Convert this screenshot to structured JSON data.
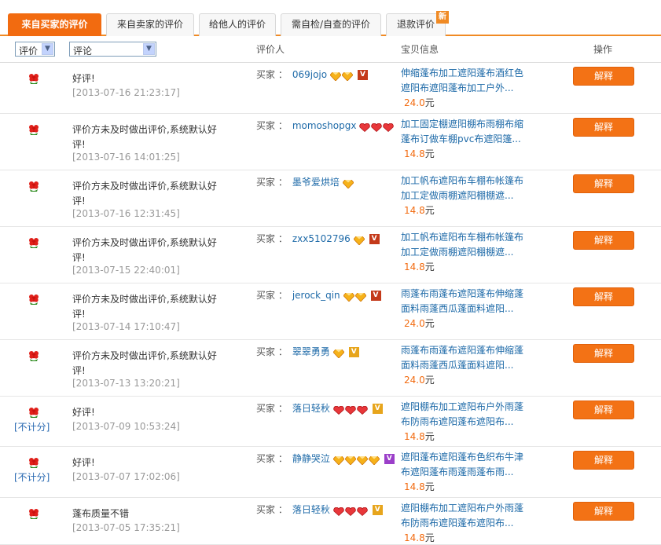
{
  "tabs": [
    {
      "label": "来自买家的评价",
      "active": true
    },
    {
      "label": "来自卖家的评价",
      "active": false
    },
    {
      "label": "给他人的评价",
      "active": false
    },
    {
      "label": "需自检/自查的评价",
      "active": false
    },
    {
      "label": "退款评价",
      "active": false
    }
  ],
  "new_badge": "新",
  "header": {
    "filter_rating": "评价",
    "filter_comment": "评论",
    "col_rater": "评价人",
    "col_item": "宝贝信息",
    "col_action": "操作"
  },
  "colors": {
    "accent": "#f26b10",
    "link": "#1e6aa8",
    "button": "#f37215"
  },
  "rows": [
    {
      "comment": "好评!",
      "time": "[2013-07-16 21:23:17]",
      "no_count": "",
      "buyer_label": "买家 ：",
      "buyer": "069jojo",
      "badges": [
        "diamond",
        "diamond"
      ],
      "level": "tall",
      "item": "伸缩蓬布加工遮阳蓬布酒红色遮阳布遮阳蓬布加工户外...",
      "price": "24.0",
      "price_unit": "元",
      "action": "解释"
    },
    {
      "comment": "评价方未及时做出评价,系统默认好评!",
      "time": "[2013-07-16 14:01:25]",
      "no_count": "",
      "buyer_label": "买家 ：",
      "buyer": "momoshopgx",
      "badges": [
        "heart",
        "heart",
        "heart"
      ],
      "level": "",
      "item": "加工固定棚遮阳棚布雨棚布缩蓬布订做车棚pvc布遮阳篷...",
      "price": "14.8",
      "price_unit": "元",
      "action": "解释"
    },
    {
      "comment": "评价方未及时做出评价,系统默认好评!",
      "time": "[2013-07-16 12:31:45]",
      "no_count": "",
      "buyer_label": "买家 ：",
      "buyer": "墨爷爱烘培",
      "badges": [
        "diamond"
      ],
      "level": "",
      "item": "加工帆布遮阳布车棚布帐篷布加工定做雨棚遮阳棚棚遮...",
      "price": "14.8",
      "price_unit": "元",
      "action": "解释"
    },
    {
      "comment": "评价方未及时做出评价,系统默认好评!",
      "time": "[2013-07-15 22:40:01]",
      "no_count": "",
      "buyer_label": "买家 ：",
      "buyer": "zxx5102796",
      "badges": [
        "diamond"
      ],
      "level": "tall",
      "item": "加工帆布遮阳布车棚布帐篷布加工定做雨棚遮阳棚棚遮...",
      "price": "14.8",
      "price_unit": "元",
      "action": "解释"
    },
    {
      "comment": "评价方未及时做出评价,系统默认好评!",
      "time": "[2013-07-14 17:10:47]",
      "no_count": "",
      "buyer_label": "买家 ：",
      "buyer": "jerock_qin",
      "badges": [
        "diamond",
        "diamond"
      ],
      "level": "tall",
      "item": "雨蓬布雨蓬布遮阳蓬布伸缩蓬面料雨蓬西瓜蓬面料遮阳...",
      "price": "24.0",
      "price_unit": "元",
      "action": "解释"
    },
    {
      "comment": "评价方未及时做出评价,系统默认好评!",
      "time": "[2013-07-13 13:20:21]",
      "no_count": "",
      "buyer_label": "买家 ：",
      "buyer": "翠翠勇勇",
      "badges": [
        "diamond"
      ],
      "level": "gold",
      "item": "雨蓬布雨蓬布遮阳蓬布伸缩蓬面料雨蓬西瓜蓬面料遮阳...",
      "price": "24.0",
      "price_unit": "元",
      "action": "解释"
    },
    {
      "comment": "好评!",
      "time": "[2013-07-09 10:53:24]",
      "no_count": "[不计分]",
      "buyer_label": "买家 ：",
      "buyer": "落日轻秋",
      "badges": [
        "heart",
        "heart",
        "heart"
      ],
      "level": "gold",
      "item": "遮阳棚布加工遮阳布户外雨蓬布防雨布遮阳蓬布遮阳布...",
      "price": "14.8",
      "price_unit": "元",
      "action": "解释"
    },
    {
      "comment": "好评!",
      "time": "[2013-07-07 17:02:06]",
      "no_count": "[不计分]",
      "buyer_label": "买家 ：",
      "buyer": "静静哭泣",
      "badges": [
        "diamond",
        "diamond",
        "diamond",
        "diamond"
      ],
      "level": "purple",
      "item": "遮阳蓬布遮阳蓬布色织布牛津布遮阳蓬布雨蓬雨蓬布雨...",
      "price": "14.8",
      "price_unit": "元",
      "action": "解释"
    },
    {
      "comment": "蓬布质量不错",
      "time": "[2013-07-05 17:35:21]",
      "no_count": "",
      "buyer_label": "买家 ：",
      "buyer": "落日轻秋",
      "badges": [
        "heart",
        "heart",
        "heart"
      ],
      "level": "gold",
      "item": "遮阳棚布加工遮阳布户外雨蓬布防雨布遮阳蓬布遮阳布...",
      "price": "14.8",
      "price_unit": "元",
      "action": "解释"
    }
  ]
}
